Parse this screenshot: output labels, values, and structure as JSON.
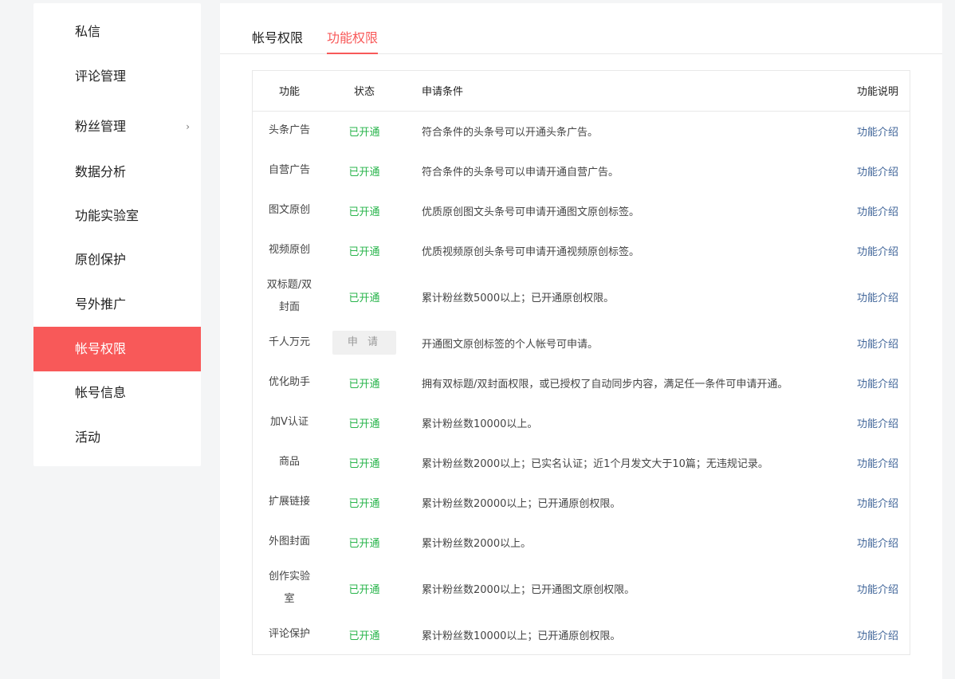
{
  "sidebar": {
    "items": [
      {
        "label": "私信",
        "active": false
      },
      {
        "label": "评论管理",
        "active": false
      },
      {
        "label": "粉丝管理",
        "active": false,
        "chevron": "›"
      },
      {
        "label": "数据分析",
        "active": false
      },
      {
        "label": "功能实验室",
        "active": false
      },
      {
        "label": "原创保护",
        "active": false
      },
      {
        "label": "号外推广",
        "active": false
      },
      {
        "label": "帐号权限",
        "active": true
      },
      {
        "label": "帐号信息",
        "active": false
      },
      {
        "label": "活动",
        "active": false
      }
    ]
  },
  "tabs": [
    {
      "label": "帐号权限",
      "active": false
    },
    {
      "label": "功能权限",
      "active": true
    }
  ],
  "table": {
    "headers": {
      "name": "功能",
      "status": "状态",
      "condition": "申请条件",
      "desc": "功能说明"
    },
    "rows": [
      {
        "name": "头条广告",
        "status": "已开通",
        "condition": "符合条件的头条号可以开通头条广告。",
        "desc": "功能介绍"
      },
      {
        "name": "自营广告",
        "status": "已开通",
        "condition": "符合条件的头条号可以申请开通自营广告。",
        "desc": "功能介绍"
      },
      {
        "name": "图文原创",
        "status": "已开通",
        "condition": "优质原创图文头条号可申请开通图文原创标签。",
        "desc": "功能介绍"
      },
      {
        "name": "视频原创",
        "status": "已开通",
        "condition": "优质视频原创头条号可申请开通视频原创标签。",
        "desc": "功能介绍"
      },
      {
        "name": "双标题/双封面",
        "status": "已开通",
        "condition": "累计粉丝数5000以上；已开通原创权限。",
        "desc": "功能介绍"
      },
      {
        "name": "千人万元",
        "status": "申 请",
        "condition": "开通图文原创标签的个人帐号可申请。",
        "desc": "功能介绍"
      },
      {
        "name": "优化助手",
        "status": "已开通",
        "condition": "拥有双标题/双封面权限，或已授权了自动同步内容，满足任一条件可申请开通。",
        "desc": "功能介绍"
      },
      {
        "name": "加V认证",
        "status": "已开通",
        "condition": "累计粉丝数10000以上。",
        "desc": "功能介绍"
      },
      {
        "name": "商品",
        "status": "已开通",
        "condition": "累计粉丝数2000以上；已实名认证；近1个月发文大于10篇；无违规记录。",
        "desc": "功能介绍"
      },
      {
        "name": "扩展链接",
        "status": "已开通",
        "condition": "累计粉丝数20000以上；已开通原创权限。",
        "desc": "功能介绍"
      },
      {
        "name": "外图封面",
        "status": "已开通",
        "condition": "累计粉丝数2000以上。",
        "desc": "功能介绍"
      },
      {
        "name": "创作实验室",
        "status": "已开通",
        "condition": "累计粉丝数2000以上；已开通图文原创权限。",
        "desc": "功能介绍"
      },
      {
        "name": "评论保护",
        "status": "已开通",
        "condition": "累计粉丝数10000以上；已开通原创权限。",
        "desc": "功能介绍"
      }
    ]
  },
  "colors": {
    "accent": "#f85959",
    "ok": "#28b44b",
    "link": "#406599"
  }
}
